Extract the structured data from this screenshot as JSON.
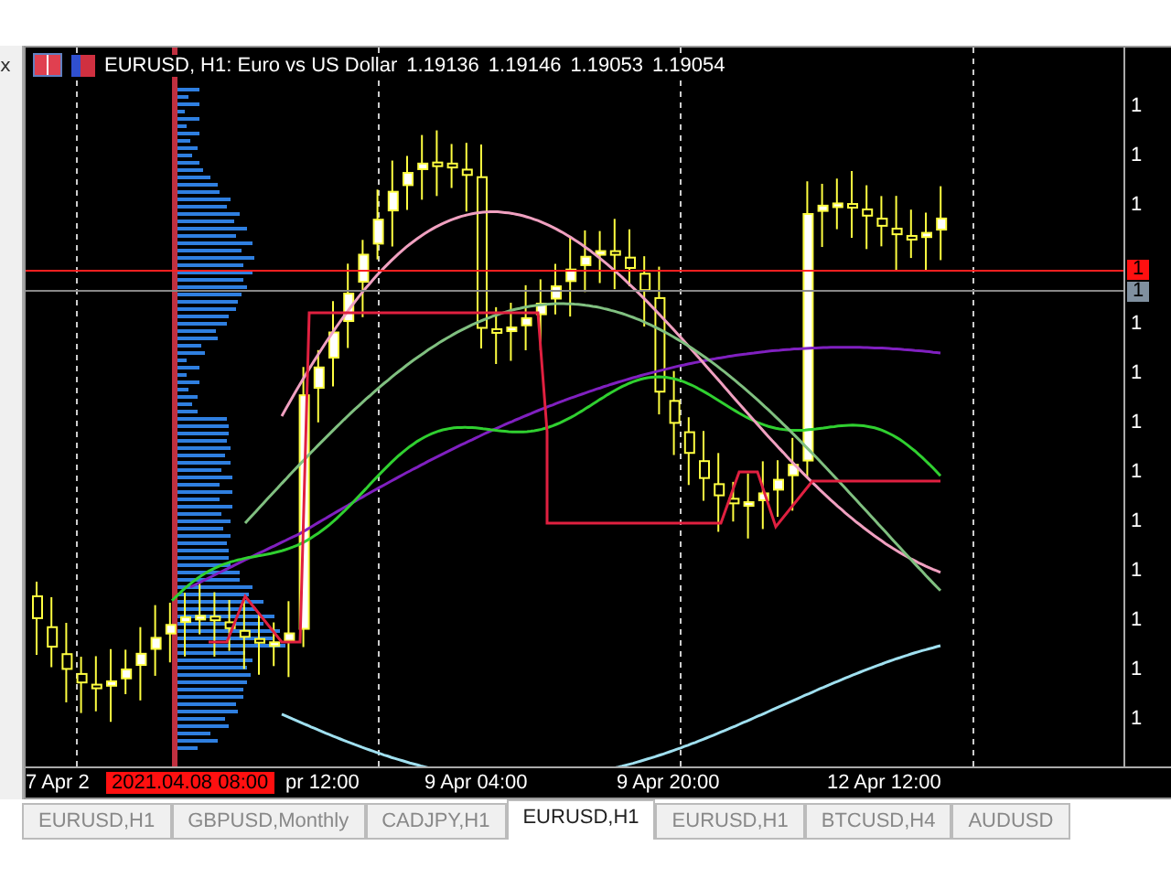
{
  "window": {
    "close": "x"
  },
  "chart": {
    "symbol_header": "EURUSD, H1:  Euro vs US Dollar",
    "quotes": [
      "1.19136",
      "1.19146",
      "1.19053",
      "1.19054"
    ],
    "price_axis": [
      "1",
      "1",
      "1",
      "1",
      "1",
      "1",
      "1",
      "1",
      "1",
      "1",
      "1",
      "1"
    ],
    "ask_label": "1",
    "bid_label": "1",
    "time_axis": [
      "7 Apr 2",
      "pr 12:00",
      "9 Apr 04:00",
      "9 Apr 20:00",
      "12 Apr 12:00"
    ],
    "crosshair_time": "2021.04.08 08:00"
  },
  "tabs": [
    {
      "label": "EURUSD,H1",
      "selected": false
    },
    {
      "label": "GBPUSD,Monthly",
      "selected": false
    },
    {
      "label": "CADJPY,H1",
      "selected": false
    },
    {
      "label": "EURUSD,H1",
      "selected": true
    },
    {
      "label": "EURUSD,H1",
      "selected": false
    },
    {
      "label": "BTCUSD,H4",
      "selected": false
    },
    {
      "label": "AUDUSD",
      "selected": false
    }
  ]
}
